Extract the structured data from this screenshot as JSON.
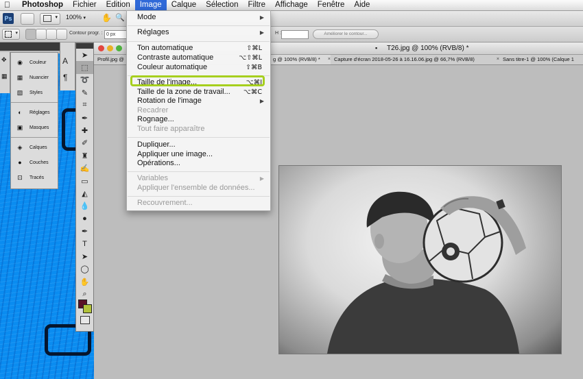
{
  "menubar": {
    "app_name": "Photoshop",
    "items": [
      "Fichier",
      "Edition",
      "Image",
      "Calque",
      "Sélection",
      "Filtre",
      "Affichage",
      "Fenêtre",
      "Aide"
    ],
    "active_item": "Image"
  },
  "appbar": {
    "ps_label": "Ps",
    "zoom": "100%"
  },
  "options_bar": {
    "contour_label": "Contour progr. :",
    "contour_value": "0 px",
    "h_label": "H :",
    "refine_button": "Améliorer le contour..."
  },
  "panels": {
    "groups": [
      [
        "Couleur",
        "Nuancier",
        "Styles"
      ],
      [
        "Réglages",
        "Masques"
      ],
      [
        "Calques",
        "Couches",
        "Tracés"
      ]
    ]
  },
  "document": {
    "title": "T26.jpg @ 100% (RVB/8) *",
    "tabs": [
      "Profil.jpg @",
      "g @ 100% (RVB/8) *",
      "Capture d'écran 2018-05-26 à 16.16.06.jpg @ 66,7% (RVB/8)",
      "Sans titre-1 @ 100% (Calque 1"
    ]
  },
  "image_menu": {
    "items": [
      {
        "label": "Mode",
        "submenu": true
      },
      {
        "label": "Réglages",
        "submenu": true
      },
      {
        "label": "Ton automatique",
        "shortcut": "⇧⌘L"
      },
      {
        "label": "Contraste automatique",
        "shortcut": "⌥⇧⌘L"
      },
      {
        "label": "Couleur automatique",
        "shortcut": "⇧⌘B"
      },
      {
        "label": "Taille de l'image...",
        "shortcut": "⌥⌘I",
        "highlighted": true
      },
      {
        "label": "Taille de la zone de travail...",
        "shortcut": "⌥⌘C"
      },
      {
        "label": "Rotation de l'image",
        "submenu": true
      },
      {
        "label": "Recadrer",
        "disabled": true
      },
      {
        "label": "Rognage..."
      },
      {
        "label": "Tout faire apparaître",
        "disabled": true
      },
      {
        "label": "Dupliquer..."
      },
      {
        "label": "Appliquer une image..."
      },
      {
        "label": "Opérations..."
      },
      {
        "label": "Variables",
        "submenu": true,
        "disabled": true
      },
      {
        "label": "Appliquer l'ensemble de données...",
        "disabled": true
      },
      {
        "label": "Recouvrement...",
        "disabled": true
      }
    ]
  },
  "colors": {
    "menu_highlight": "#2f69d8",
    "annotation_green": "#a6cf1e",
    "foreground_color": "#5a1026",
    "background_color": "#b2c23a",
    "canvas_blue": "#0a8cf0"
  }
}
